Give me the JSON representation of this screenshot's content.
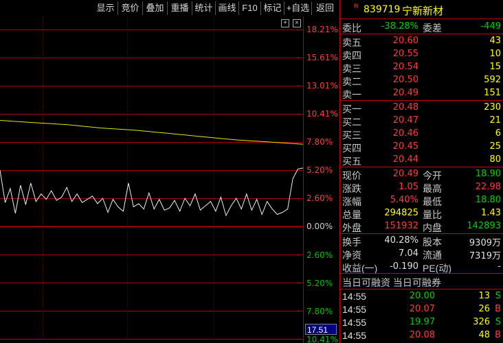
{
  "toolbar": {
    "buttons": [
      "显示",
      "竞价",
      "叠加",
      "重播",
      "统计",
      "画线",
      "F10",
      "标记",
      "+自选",
      "返回"
    ]
  },
  "chart": {
    "pct_labels": [
      "18.21%",
      "15.61%",
      "13.01%",
      "10.41%",
      "7.80%",
      "5.20%",
      "2.60%",
      "0.00%",
      "2.60%",
      "5.20%",
      "7.80%",
      "10.41%"
    ],
    "cursor_value": "17.51"
  },
  "chart_data": {
    "type": "line",
    "series": [
      {
        "values": [
          9.8,
          9.6,
          9.4,
          9.1,
          8.9,
          8.6,
          8.3,
          8.0,
          7.8,
          7.6
        ]
      },
      {
        "values": [
          5.2,
          2.2,
          3.5,
          1.2,
          3.8,
          2.0,
          4.0,
          2.3,
          3.0,
          2.5,
          3.3,
          2.4,
          2.7,
          3.6,
          2.3,
          3.0,
          2.2,
          2.5,
          2.8,
          2.1,
          2.6,
          1.3,
          2.5,
          1.8,
          1.4,
          4.0,
          1.8,
          2.1,
          1.6,
          3.1,
          1.6,
          2.5,
          1.5,
          1.7,
          2.4,
          1.4,
          2.6,
          1.9,
          3.0,
          1.5,
          1.9,
          2.3,
          1.4,
          2.7,
          1.0,
          1.9,
          2.6,
          1.6,
          3.0,
          1.5,
          2.5,
          1.1,
          2.3,
          1.6,
          1.1,
          1.3,
          1.6,
          4.4,
          5.3,
          5.4
        ]
      }
    ],
    "ylim": [
      -10.41,
      18.21
    ],
    "grid": true
  },
  "quote": {
    "code": "839719",
    "name": "宁新新材",
    "wei_bi_label": "委比",
    "wei_bi": "-38.28%",
    "wei_cha_label": "委差",
    "wei_cha": "-449",
    "sell": [
      {
        "label": "卖五",
        "price": "20.60",
        "vol": "43"
      },
      {
        "label": "卖四",
        "price": "20.55",
        "vol": "10"
      },
      {
        "label": "卖三",
        "price": "20.54",
        "vol": "15"
      },
      {
        "label": "卖二",
        "price": "20.50",
        "vol": "592"
      },
      {
        "label": "卖一",
        "price": "20.49",
        "vol": "151"
      }
    ],
    "buy": [
      {
        "label": "买一",
        "price": "20.48",
        "vol": "230"
      },
      {
        "label": "买二",
        "price": "20.47",
        "vol": "21"
      },
      {
        "label": "买三",
        "price": "20.46",
        "vol": "6"
      },
      {
        "label": "买四",
        "price": "20.45",
        "vol": "25"
      },
      {
        "label": "买五",
        "price": "20.44",
        "vol": "80"
      }
    ],
    "stats": [
      {
        "l1": "现价",
        "v1": "20.49",
        "l2": "今开",
        "v2": "18.90"
      },
      {
        "l1": "涨跌",
        "v1": "1.05",
        "l2": "最高",
        "v2": "22.98"
      },
      {
        "l1": "涨幅",
        "v1": "5.40%",
        "l2": "最低",
        "v2": "18.80"
      },
      {
        "l1": "总量",
        "v1": "294825",
        "l2": "量比",
        "v2": "1.43"
      },
      {
        "l1": "外盘",
        "v1": "151932",
        "l2": "内盘",
        "v2": "142893"
      }
    ],
    "info": [
      {
        "l1": "换手",
        "v1": "40.28%",
        "l2": "股本",
        "v2": "9309万"
      },
      {
        "l1": "净资",
        "v1": "7.04",
        "l2": "流通",
        "v2": "7319万"
      },
      {
        "l1": "收益(一)",
        "v1": "-0.190",
        "l2": "PE(动)",
        "v2": "-"
      }
    ],
    "margin_header": "当日可融资 当日可融券",
    "ticks": [
      {
        "time": "14:55",
        "price": "20.00",
        "vol": "13",
        "side": "S"
      },
      {
        "time": "14:55",
        "price": "20.07",
        "vol": "26",
        "side": "B"
      },
      {
        "time": "14:55",
        "price": "19.97",
        "vol": "326",
        "side": "S"
      },
      {
        "time": "14:55",
        "price": "20.08",
        "vol": "48",
        "side": "B"
      }
    ]
  }
}
